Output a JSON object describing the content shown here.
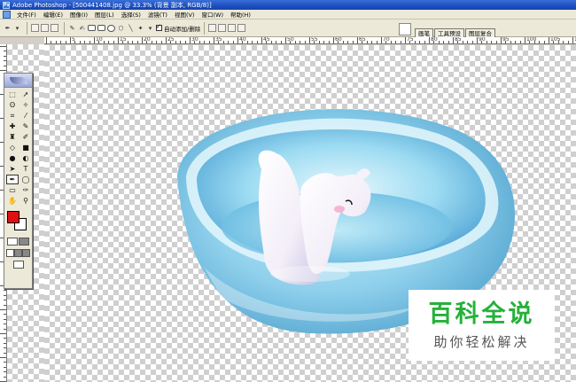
{
  "window": {
    "title": "Adobe Photoshop - [500441408.jpg @ 33.3% (背景 副本, RGB/8)]"
  },
  "menu": {
    "items": [
      "文件(F)",
      "编辑(E)",
      "图像(I)",
      "图层(L)",
      "选择(S)",
      "滤镜(T)",
      "视图(V)",
      "窗口(W)",
      "帮助(H)"
    ]
  },
  "options": {
    "auto_add_delete_label": "自动添加/删除",
    "auto_add_delete_checked": true
  },
  "palette_well": {
    "tabs": [
      "画笔",
      "工具预设",
      "图层复合"
    ]
  },
  "ruler": {
    "h_labels": [
      "5",
      "10",
      "15",
      "20",
      "25",
      "30",
      "35",
      "40",
      "45",
      "50",
      "55",
      "60",
      "65",
      "70",
      "75",
      "80",
      "85",
      "90",
      "95",
      "100",
      "105",
      "110"
    ]
  },
  "toolbox": {
    "foreground_color": "#e01010",
    "background_color": "#ffffff"
  },
  "watermark": {
    "title": "百科全说",
    "subtitle": "助你轻松解决",
    "title_color": "#25b13a"
  }
}
